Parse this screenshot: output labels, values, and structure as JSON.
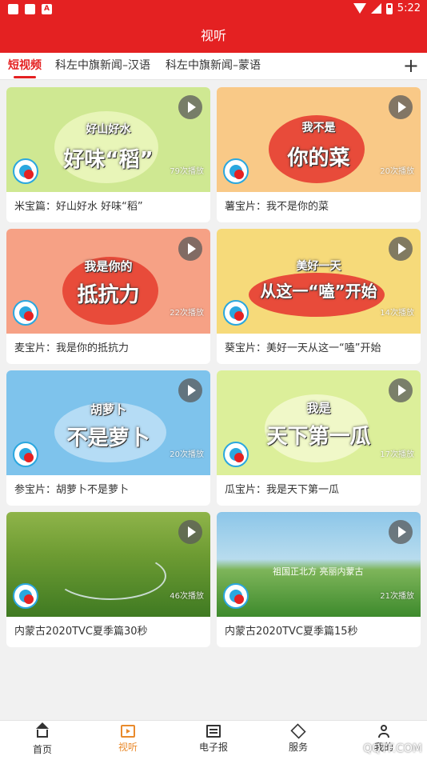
{
  "status_bar": {
    "time": "5:22"
  },
  "header": {
    "title": "视听"
  },
  "tabs": [
    {
      "label": "短视频",
      "active": true
    },
    {
      "label": "科左中旗新闻–汉语",
      "active": false
    },
    {
      "label": "科左中旗新闻–蒙语",
      "active": false
    }
  ],
  "add_tab_label": "+",
  "videos": [
    {
      "thumb_text": "好味“稻”",
      "thumb_subtext": "好山好水",
      "plays": "79次播放",
      "caption": "米宝篇：好山好水  好味“稻”"
    },
    {
      "thumb_text": "你的菜",
      "thumb_subtext": "我不是",
      "plays": "20次播放",
      "caption": "薯宝片：我不是你的菜"
    },
    {
      "thumb_text": "抵抗力",
      "thumb_subtext": "我是你的",
      "plays": "22次播放",
      "caption": "麦宝片：我是你的抵抗力"
    },
    {
      "thumb_text": "从这一“嗑”开始",
      "thumb_subtext": "美好一天",
      "plays": "14次播放",
      "caption": "葵宝片：美好一天从这一“嗑”开始"
    },
    {
      "thumb_text": "不是萝卜",
      "thumb_subtext": "胡萝卜",
      "plays": "20次播放",
      "caption": "参宝片：胡萝卜不是萝卜"
    },
    {
      "thumb_text": "天下第一瓜",
      "thumb_subtext": "我是",
      "plays": "17次播放",
      "caption": "瓜宝片：我是天下第一瓜"
    },
    {
      "thumb_text": "",
      "thumb_subtext": "",
      "plays": "46次播放",
      "caption": "内蒙古2020TVC夏季篇30秒"
    },
    {
      "thumb_text": "祖国正北方 亮丽内蒙古",
      "thumb_subtext": "",
      "plays": "21次播放",
      "caption": "内蒙古2020TVC夏季篇15秒"
    }
  ],
  "bottom_nav": [
    {
      "label": "首页",
      "icon": "home-icon",
      "active": false
    },
    {
      "label": "视听",
      "icon": "tv-icon",
      "active": true
    },
    {
      "label": "电子报",
      "icon": "newspaper-icon",
      "active": false
    },
    {
      "label": "服务",
      "icon": "layers-icon",
      "active": false
    },
    {
      "label": "我的",
      "icon": "user-icon",
      "active": false
    }
  ],
  "watermark": "QQTF.COM",
  "colors": {
    "brand_red": "#e42122",
    "active_nav": "#e98a2c"
  }
}
